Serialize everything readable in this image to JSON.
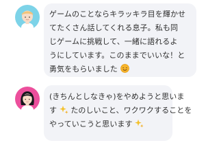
{
  "messages": [
    {
      "avatar": "child-avatar-icon",
      "lines": [
        "ゲームのことならキラッキラ目を輝かせ",
        "てたくさん話してくれる息子。私も同",
        "じゲームに挑戦して、一緒に語れるよ",
        "うにしています。このままでいいな！と",
        "勇気をもらいました"
      ],
      "trailing_icon": "smile-emoji-icon"
    },
    {
      "avatar": "woman-avatar-icon",
      "lines": [
        "(きちんとしなきゃ)をやめようと思いま",
        "す",
        "たのしいこと、ワクワクすることを",
        "やっていこうと思います"
      ],
      "icons": [
        "sparkles-icon",
        "sparkles-icon"
      ]
    }
  ],
  "colors": {
    "bubble_background": "#f2f3f7",
    "text": "#2f2f2f",
    "avatar1_background": "#7dd3e8",
    "avatar2_background": "#ec4f9c"
  }
}
